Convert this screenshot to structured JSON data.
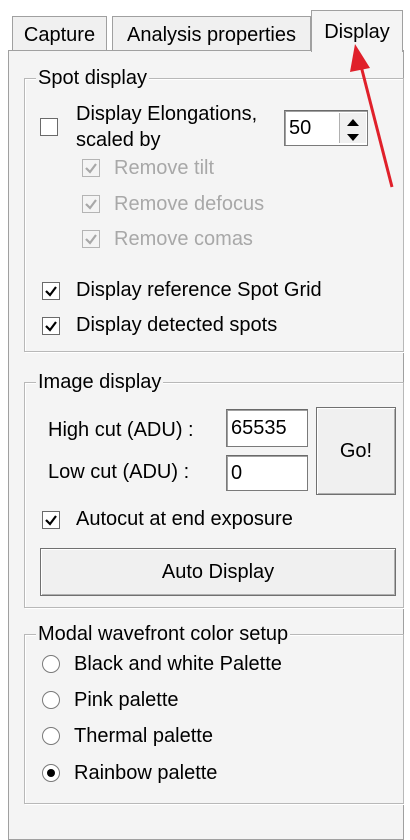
{
  "tabs": [
    {
      "label": "Capture",
      "active": false
    },
    {
      "label": "Analysis properties",
      "active": false
    },
    {
      "label": "Display",
      "active": true
    }
  ],
  "spot_display": {
    "title": "Spot display",
    "display_elongations": {
      "label_line1": "Display Elongations,",
      "label_line2": "scaled by",
      "checked": false
    },
    "scale_value": "50",
    "remove_tilt": {
      "label": "Remove tilt",
      "checked": true,
      "enabled": false
    },
    "remove_defocus": {
      "label": "Remove defocus",
      "checked": true,
      "enabled": false
    },
    "remove_comas": {
      "label": "Remove comas",
      "checked": true,
      "enabled": false
    },
    "reference_grid": {
      "label": "Display reference Spot Grid",
      "checked": true
    },
    "detected_spots": {
      "label": "Display detected spots",
      "checked": true
    }
  },
  "image_display": {
    "title": "Image display",
    "high_cut_label": "High cut (ADU) :",
    "high_cut_value": "65535",
    "low_cut_label": "Low cut (ADU) :",
    "low_cut_value": "0",
    "go_label": "Go!",
    "autocut": {
      "label": "Autocut at end exposure",
      "checked": true
    },
    "auto_display_label": "Auto Display"
  },
  "wavefront": {
    "title": "Modal wavefront color setup",
    "options": [
      {
        "label": "Black and white Palette",
        "selected": false
      },
      {
        "label": "Pink palette",
        "selected": false
      },
      {
        "label": "Thermal palette",
        "selected": false
      },
      {
        "label": "Rainbow palette",
        "selected": true
      }
    ]
  },
  "annotation": {
    "color": "#e0202a",
    "icon": "arrow-icon"
  }
}
